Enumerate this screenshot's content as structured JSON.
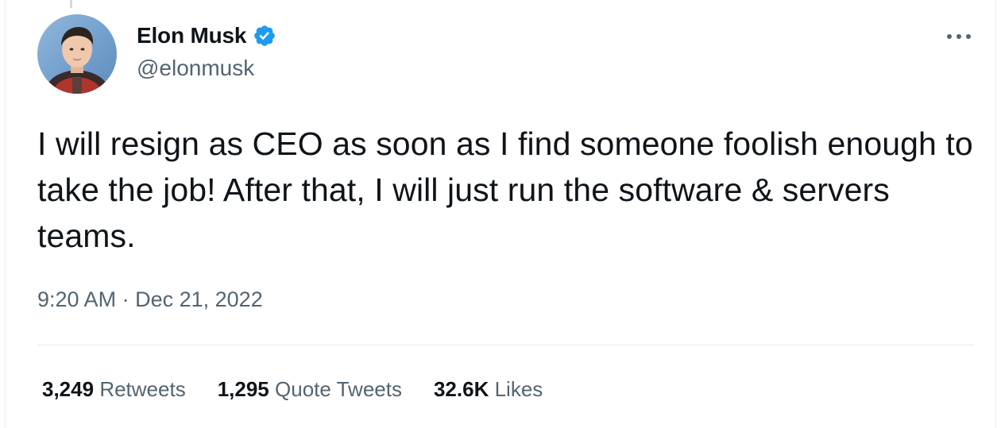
{
  "author": {
    "display_name": "Elon Musk",
    "handle": "@elonmusk",
    "verified": true,
    "avatar_icon": "avatar-photo"
  },
  "tweet": {
    "text": "I will resign as CEO as soon as I find someone foolish enough to take the job! After that, I will just run the software & servers teams.",
    "time": "9:20 AM",
    "separator": "·",
    "date": "Dec 21, 2022"
  },
  "stats": {
    "retweets": {
      "count": "3,249",
      "label": "Retweets"
    },
    "quote_tweets": {
      "count": "1,295",
      "label": "Quote Tweets"
    },
    "likes": {
      "count": "32.6K",
      "label": "Likes"
    }
  },
  "icons": {
    "more": "more-horizontal-icon",
    "verified": "verified-badge-icon"
  },
  "colors": {
    "primary_text": "#0f1419",
    "secondary_text": "#536471",
    "verified_blue": "#1d9bf0",
    "divider": "#e3e7ea"
  }
}
